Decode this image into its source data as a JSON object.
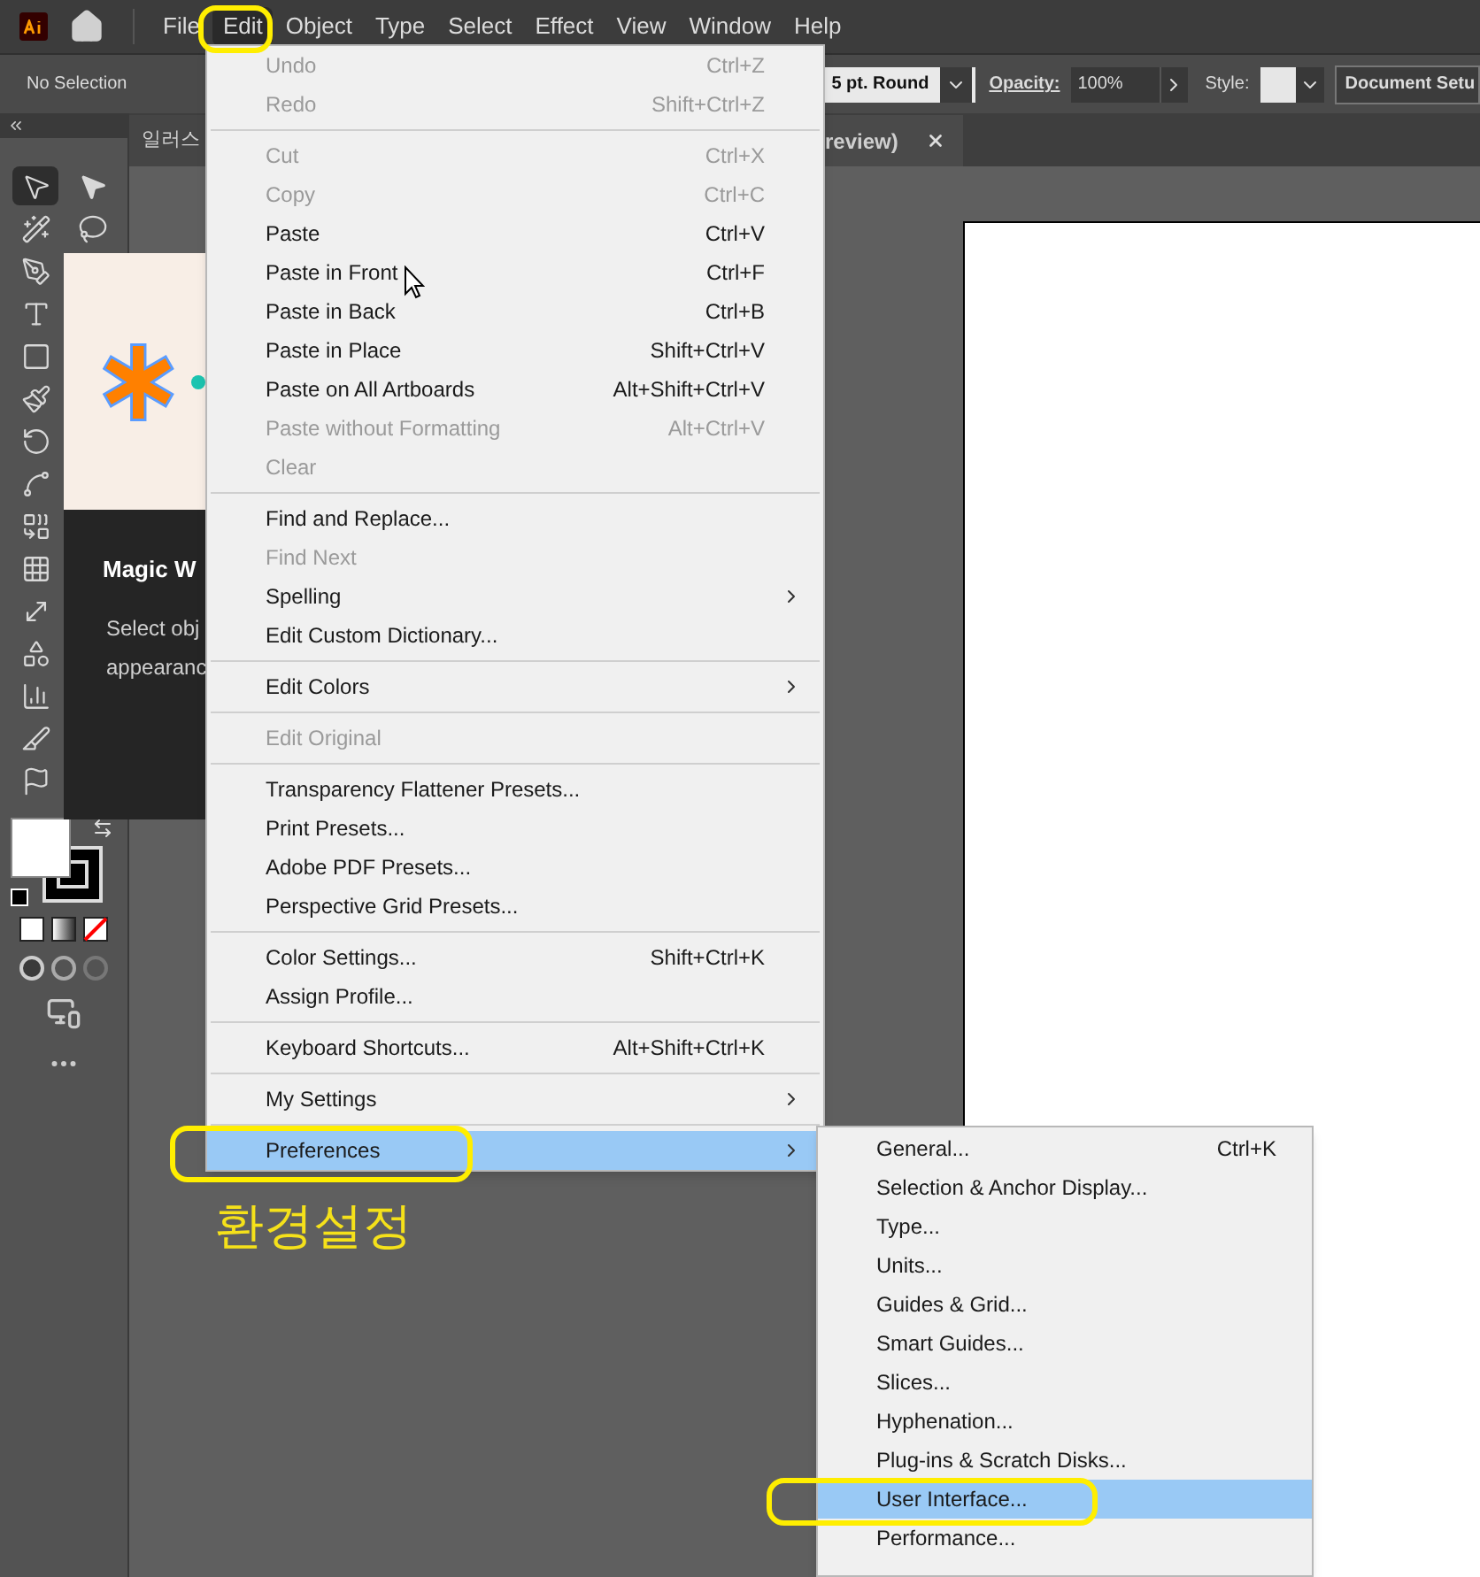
{
  "menubar": {
    "items": [
      {
        "label": "File",
        "selected": false
      },
      {
        "label": "Edit",
        "selected": true
      },
      {
        "label": "Object",
        "selected": false
      },
      {
        "label": "Type",
        "selected": false
      },
      {
        "label": "Select",
        "selected": false
      },
      {
        "label": "Effect",
        "selected": false
      },
      {
        "label": "View",
        "selected": false
      },
      {
        "label": "Window",
        "selected": false
      },
      {
        "label": "Help",
        "selected": false
      }
    ]
  },
  "control_bar": {
    "selection": "No Selection",
    "brush": "5 pt. Round",
    "opacity_label": "Opacity:",
    "opacity": "100%",
    "style_label": "Style:",
    "document_setup": "Document Setu"
  },
  "tabs": [
    {
      "label": "일러스",
      "selected": false
    },
    {
      "label": "review)",
      "selected": true
    }
  ],
  "toolbar": {
    "tools": [
      {
        "selected": true
      },
      {
        "selected": false
      },
      {
        "selected": false
      },
      {
        "selected": false
      },
      {
        "selected": false
      },
      {
        "selected": false
      },
      {
        "selected": false
      },
      {
        "selected": false
      },
      {
        "selected": false
      },
      {
        "selected": false
      },
      {
        "selected": false
      },
      {
        "selected": false
      },
      {
        "selected": false
      },
      {
        "selected": false
      },
      {
        "selected": false
      },
      {
        "selected": false
      },
      {
        "selected": false
      }
    ]
  },
  "tooltip": {
    "title": "Magic W",
    "description_lines": [
      "Select obj",
      "appearanc"
    ]
  },
  "edit_menu": {
    "groups": [
      [
        {
          "label": "Undo",
          "shortcut": "Ctrl+Z",
          "disabled": true,
          "submenu": false,
          "selected": false
        },
        {
          "label": "Redo",
          "shortcut": "Shift+Ctrl+Z",
          "disabled": true,
          "submenu": false,
          "selected": false
        }
      ],
      [
        {
          "label": "Cut",
          "shortcut": "Ctrl+X",
          "disabled": true,
          "submenu": false,
          "selected": false
        },
        {
          "label": "Copy",
          "shortcut": "Ctrl+C",
          "disabled": true,
          "submenu": false,
          "selected": false
        },
        {
          "label": "Paste",
          "shortcut": "Ctrl+V",
          "disabled": false,
          "submenu": false,
          "selected": false
        },
        {
          "label": "Paste in Front",
          "shortcut": "Ctrl+F",
          "disabled": false,
          "submenu": false,
          "selected": false
        },
        {
          "label": "Paste in Back",
          "shortcut": "Ctrl+B",
          "disabled": false,
          "submenu": false,
          "selected": false
        },
        {
          "label": "Paste in Place",
          "shortcut": "Shift+Ctrl+V",
          "disabled": false,
          "submenu": false,
          "selected": false
        },
        {
          "label": "Paste on All Artboards",
          "shortcut": "Alt+Shift+Ctrl+V",
          "disabled": false,
          "submenu": false,
          "selected": false
        },
        {
          "label": "Paste without Formatting",
          "shortcut": "Alt+Ctrl+V",
          "disabled": true,
          "submenu": false,
          "selected": false
        },
        {
          "label": "Clear",
          "disabled": true,
          "submenu": false,
          "selected": false
        }
      ],
      [
        {
          "label": "Find and Replace...",
          "disabled": false,
          "submenu": false,
          "selected": false
        },
        {
          "label": "Find Next",
          "disabled": true,
          "submenu": false,
          "selected": false
        },
        {
          "label": "Spelling",
          "disabled": false,
          "submenu": true,
          "selected": false
        },
        {
          "label": "Edit Custom Dictionary...",
          "disabled": false,
          "submenu": false,
          "selected": false
        }
      ],
      [
        {
          "label": "Edit Colors",
          "disabled": false,
          "submenu": true,
          "selected": false
        }
      ],
      [
        {
          "label": "Edit Original",
          "disabled": true,
          "submenu": false,
          "selected": false
        }
      ],
      [
        {
          "label": "Transparency Flattener Presets...",
          "disabled": false,
          "submenu": false,
          "selected": false
        },
        {
          "label": "Print Presets...",
          "disabled": false,
          "submenu": false,
          "selected": false
        },
        {
          "label": "Adobe PDF Presets...",
          "disabled": false,
          "submenu": false,
          "selected": false
        },
        {
          "label": "Perspective Grid Presets...",
          "disabled": false,
          "submenu": false,
          "selected": false
        }
      ],
      [
        {
          "label": "Color Settings...",
          "shortcut": "Shift+Ctrl+K",
          "disabled": false,
          "submenu": false,
          "selected": false
        },
        {
          "label": "Assign Profile...",
          "disabled": false,
          "submenu": false,
          "selected": false
        }
      ],
      [
        {
          "label": "Keyboard Shortcuts...",
          "shortcut": "Alt+Shift+Ctrl+K",
          "disabled": false,
          "submenu": false,
          "selected": false
        }
      ],
      [
        {
          "label": "My Settings",
          "disabled": false,
          "submenu": true,
          "selected": false
        }
      ],
      [
        {
          "label": "Preferences",
          "disabled": false,
          "submenu": true,
          "selected": true
        }
      ]
    ]
  },
  "preferences_menu": {
    "items": [
      {
        "label": "General...",
        "shortcut": "Ctrl+K",
        "selected": false
      },
      {
        "label": "Selection & Anchor Display...",
        "selected": false
      },
      {
        "label": "Type...",
        "selected": false
      },
      {
        "label": "Units...",
        "selected": false
      },
      {
        "label": "Guides & Grid...",
        "selected": false
      },
      {
        "label": "Smart Guides...",
        "selected": false
      },
      {
        "label": "Slices...",
        "selected": false
      },
      {
        "label": "Hyphenation...",
        "selected": false
      },
      {
        "label": "Plug-ins & Scratch Disks...",
        "selected": false
      },
      {
        "label": "User Interface...",
        "selected": true
      },
      {
        "label": "Performance...",
        "selected": false
      }
    ]
  },
  "annotation": {
    "caption": "환경설정"
  }
}
